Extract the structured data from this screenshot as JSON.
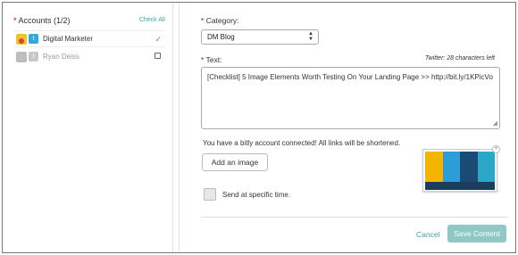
{
  "accounts": {
    "required_mark": "*",
    "title": "Accounts (1/2)",
    "check_all": "Check All",
    "items": [
      {
        "name": "Digital Marketer",
        "network": "twitter",
        "checked": true,
        "check_glyph": "✓"
      },
      {
        "name": "Ryan Deiss",
        "network": "twitter",
        "checked": false
      }
    ]
  },
  "form": {
    "category_label": "Category:",
    "category_value": "DM Blog",
    "text_label": "Text:",
    "twitter_counter": "Twitter: 28 characters left",
    "text_value": "[Checklist] 5 Image Elements Worth Testing On Your Landing Page >> http://bit.ly/1KPicVo",
    "bitly_notice": "You have a bitly account connected! All links will be shortened.",
    "add_image": "Add an image",
    "send_specific": "Send at specific time."
  },
  "footer": {
    "cancel": "Cancel",
    "save": "Save Content"
  },
  "colors": {
    "accent": "#3aa6a0",
    "required": "#d9534f",
    "save_button": "#8fc9c6",
    "twitter": "#2fa9e0"
  },
  "icons": [
    "twitter-icon",
    "checkmark-icon",
    "select-arrows-icon",
    "resize-grip-icon",
    "remove-image-icon"
  ]
}
